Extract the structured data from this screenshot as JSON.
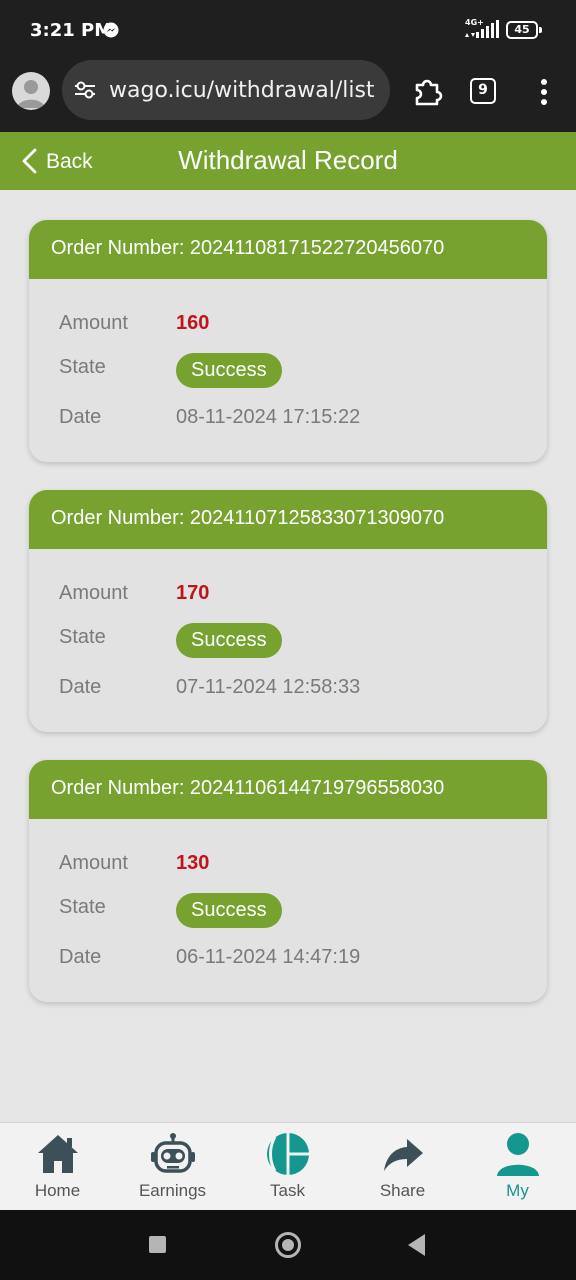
{
  "status_bar": {
    "time": "3:21 PM",
    "network": "4G+",
    "battery": "45"
  },
  "browser": {
    "url": "wago.icu/withdrawal/list",
    "tab_count": "9"
  },
  "header": {
    "back_label": "Back",
    "title": "Withdrawal Record"
  },
  "labels": {
    "amount": "Amount",
    "state": "State",
    "date": "Date"
  },
  "records": [
    {
      "order_label": "Order Number: 20241108171522720456070",
      "amount": "160",
      "state": "Success",
      "date": "08-11-2024 17:15:22"
    },
    {
      "order_label": "Order Number: 20241107125833071309070",
      "amount": "170",
      "state": "Success",
      "date": "07-11-2024 12:58:33"
    },
    {
      "order_label": "Order Number: 20241106144719796558030",
      "amount": "130",
      "state": "Success",
      "date": "06-11-2024 14:47:19"
    }
  ],
  "nav": {
    "items": [
      {
        "label": "Home",
        "icon": "home-icon"
      },
      {
        "label": "Earnings",
        "icon": "robot-icon"
      },
      {
        "label": "Task",
        "icon": "task-icon"
      },
      {
        "label": "Share",
        "icon": "share-icon"
      },
      {
        "label": "My",
        "icon": "user-icon"
      }
    ],
    "active": "My"
  },
  "colors": {
    "brand_green": "#78a22f",
    "amount_red": "#c1131b",
    "active_teal": "#13978f"
  }
}
